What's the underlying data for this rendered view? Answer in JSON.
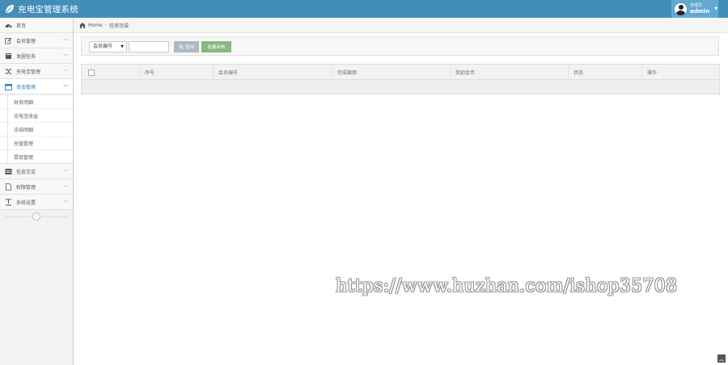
{
  "app": {
    "title": "充电宝管理系统",
    "brand_color": "#438eb9"
  },
  "user": {
    "role": "管理员",
    "name": "admin"
  },
  "sidebar": {
    "items": [
      {
        "label": "首页",
        "icon": "tachometer-icon"
      },
      {
        "label": "会员管理",
        "icon": "edit-icon"
      },
      {
        "label": "发圈任务",
        "icon": "book-icon"
      },
      {
        "label": "充电宝管理",
        "icon": "random-icon"
      },
      {
        "label": "资金管理",
        "icon": "calendar-icon",
        "active": true
      },
      {
        "label": "信息交流",
        "icon": "list-icon"
      },
      {
        "label": "权限管理",
        "icon": "file-icon"
      },
      {
        "label": "系统设置",
        "icon": "text-width-icon"
      }
    ],
    "submenu": [
      {
        "label": "财务明细"
      },
      {
        "label": "充电宝收益"
      },
      {
        "label": "冻结明细"
      },
      {
        "label": "充值管理"
      },
      {
        "label": "提现管理"
      }
    ]
  },
  "breadcrumb": {
    "home": "Home",
    "current": "任务完成"
  },
  "search": {
    "select_value": "会员编号",
    "input_value": "",
    "search_label": "查询",
    "review_label": "批量审核"
  },
  "table": {
    "columns": [
      "",
      "序号",
      "会员编号",
      "完成截图",
      "奖励金币",
      "状态",
      "操作"
    ],
    "rows": []
  },
  "watermark": "https://www.huzhan.com/ishop35708"
}
